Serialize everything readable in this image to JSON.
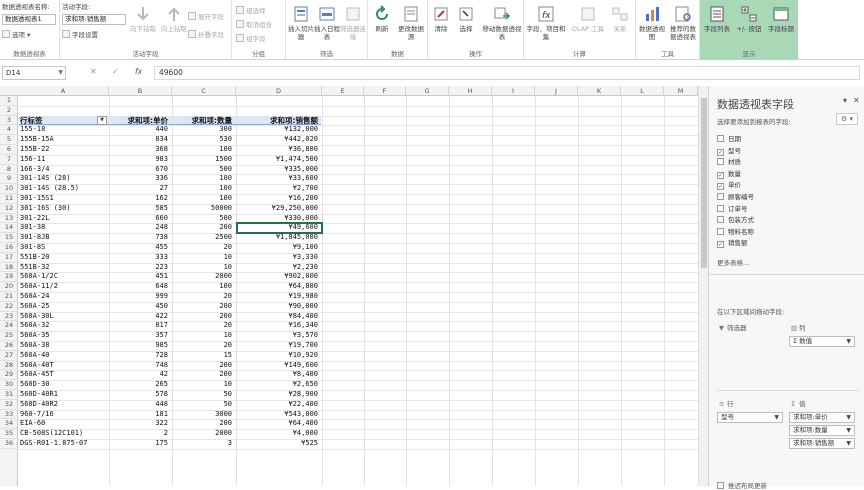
{
  "ribbon": {
    "pivot_name_label": "数据透视表名称:",
    "pivot_name_value": "数据透视表1",
    "options_label": "选项",
    "group_pivot_label": "数据透视表",
    "active_field_label": "活动字段:",
    "active_field_value": "求和项:销售额",
    "field_settings_label": "字段设置",
    "drill_down": "向下钻取",
    "drill_up": "向上钻取",
    "expand_field": "展开字段",
    "collapse_field": "折叠字段",
    "group_active_field_label": "活动字段",
    "group_selection": "组选择",
    "ungroup": "取消组合",
    "group_field": "组字段",
    "group_group_label": "分组",
    "insert_slicer": "插入切片器",
    "insert_timeline": "插入日程表",
    "filter_connections": "筛选器连接",
    "group_filter_label": "筛选",
    "refresh": "刷新",
    "change_source": "更改数据源",
    "group_data_label": "数据",
    "clear": "清除",
    "select": "选择",
    "move_pivot": "移动数据透视表",
    "group_actions_label": "操作",
    "fields_items_sets": "字段、项目和集",
    "olap_tools": "OLAP 工具",
    "relationships": "关系",
    "group_calc_label": "计算",
    "pivot_chart": "数据透视图",
    "recommended_pivot": "推荐的数据透视表",
    "group_tools_label": "工具",
    "field_list": "字段列表",
    "plus_minus_buttons": "+/- 按钮",
    "field_headers": "字段标题",
    "group_show_label": "显示"
  },
  "formula_bar": {
    "name_box": "D14",
    "cancel_icon": "✕",
    "enter_icon": "✓",
    "fx": "fx",
    "value": "49600"
  },
  "grid": {
    "columns": [
      "A",
      "B",
      "C",
      "D",
      "E",
      "F",
      "G",
      "H",
      "I",
      "J",
      "K",
      "L",
      "M"
    ],
    "header": [
      "行标签",
      "求和项:单价",
      "求和项:数量",
      "求和项:销售额"
    ],
    "rows": [
      [
        "155-18",
        "440",
        "300",
        "¥132,000"
      ],
      [
        "155B-15A",
        "834",
        "530",
        "¥442,020"
      ],
      [
        "155B-22",
        "368",
        "100",
        "¥36,800"
      ],
      [
        "156-11",
        "983",
        "1500",
        "¥1,474,500"
      ],
      [
        "166-3/4",
        "670",
        "500",
        "¥335,000"
      ],
      [
        "301-14S (28)",
        "336",
        "100",
        "¥33,600"
      ],
      [
        "301-14S (28.5)",
        "27",
        "100",
        "¥2,700"
      ],
      [
        "301-15S1",
        "162",
        "100",
        "¥16,200"
      ],
      [
        "301-16S (30)",
        "585",
        "50000",
        "¥29,250,000"
      ],
      [
        "301-22L",
        "660",
        "500",
        "¥330,000"
      ],
      [
        "301-38",
        "248",
        "200",
        "¥49,600"
      ],
      [
        "301-8JB",
        "738",
        "2500",
        "¥1,845,000"
      ],
      [
        "301-8S",
        "455",
        "20",
        "¥9,100"
      ],
      [
        "551B-20",
        "333",
        "10",
        "¥3,330"
      ],
      [
        "551B-32",
        "223",
        "10",
        "¥2,230"
      ],
      [
        "560A-1/2C",
        "451",
        "2000",
        "¥902,000"
      ],
      [
        "560A-11/2",
        "648",
        "100",
        "¥64,800"
      ],
      [
        "560A-24",
        "999",
        "20",
        "¥19,980"
      ],
      [
        "560A-25",
        "450",
        "200",
        "¥90,000"
      ],
      [
        "560A-30L",
        "422",
        "200",
        "¥84,400"
      ],
      [
        "560A-32",
        "817",
        "20",
        "¥16,340"
      ],
      [
        "560A-35",
        "357",
        "10",
        "¥3,570"
      ],
      [
        "560A-38",
        "985",
        "20",
        "¥19,700"
      ],
      [
        "560A-40",
        "728",
        "15",
        "¥10,920"
      ],
      [
        "560A-40T",
        "748",
        "200",
        "¥149,600"
      ],
      [
        "560A-45T",
        "42",
        "200",
        "¥8,400"
      ],
      [
        "560D-30",
        "265",
        "10",
        "¥2,650"
      ],
      [
        "560D-40R1",
        "578",
        "50",
        "¥28,900"
      ],
      [
        "560D-40R2",
        "448",
        "50",
        "¥22,400"
      ],
      [
        "960-7/16",
        "181",
        "3000",
        "¥543,000"
      ],
      [
        "EIA-60",
        "322",
        "200",
        "¥64,400"
      ],
      [
        "CB-508S(12C101)",
        "2",
        "2000",
        "¥4,000"
      ],
      [
        "DGS-R01-1.875-07",
        "175",
        "3",
        "¥525"
      ]
    ]
  },
  "panel": {
    "title": "数据透视表字段",
    "subtitle": "选择要添加到报表的字段:",
    "fields": [
      {
        "label": "日期",
        "checked": false
      },
      {
        "label": "型号",
        "checked": true
      },
      {
        "label": "材质",
        "checked": false
      },
      {
        "label": "数量",
        "checked": true
      },
      {
        "label": "单价",
        "checked": true
      },
      {
        "label": "顾客编号",
        "checked": false
      },
      {
        "label": "订单号",
        "checked": false
      },
      {
        "label": "包装方式",
        "checked": false
      },
      {
        "label": "物料名称",
        "checked": false
      },
      {
        "label": "销售额",
        "checked": true
      }
    ],
    "more_tables": "更多表格...",
    "drag_hint": "在以下区域间拖动字段:",
    "filter_area": "筛选器",
    "columns_area": "列",
    "rows_area": "行",
    "values_area": "值",
    "column_items": [
      "Σ 数值"
    ],
    "row_items": [
      "型号"
    ],
    "value_items": [
      "求和项:单价",
      "求和项:数量",
      "求和项:销售额"
    ],
    "defer_update": "推迟布局更新"
  }
}
